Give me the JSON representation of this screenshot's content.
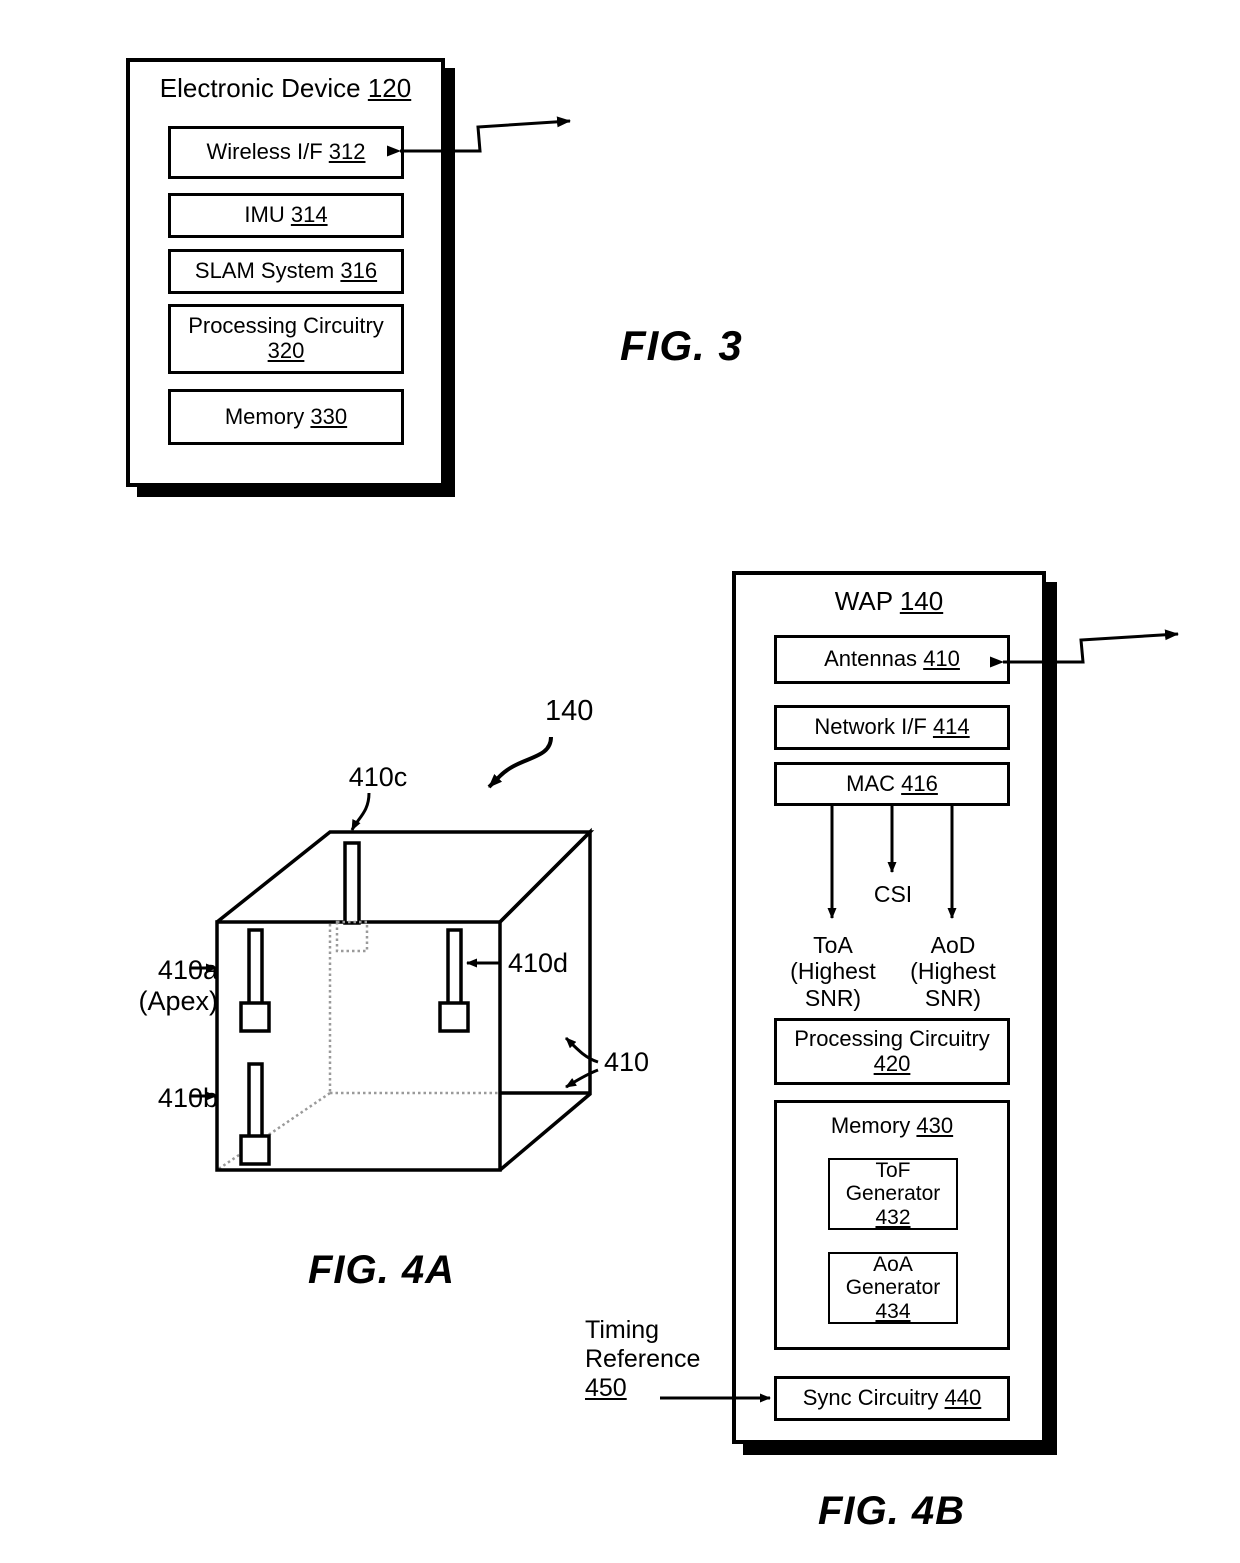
{
  "figure3": {
    "caption": "FIG. 3",
    "title_text": "Electronic Device",
    "title_ref": "120",
    "blocks": [
      {
        "label": "Wireless I/F",
        "ref": "312"
      },
      {
        "label": "IMU",
        "ref": "314"
      },
      {
        "label": "SLAM System",
        "ref": "316"
      },
      {
        "label": "Processing Circuitry",
        "ref": "320"
      },
      {
        "label": "Memory",
        "ref": "330"
      }
    ]
  },
  "figure4a": {
    "caption": "FIG. 4A",
    "device_ref": "140",
    "antenna_group_ref": "410",
    "antennas": [
      {
        "id": "410a",
        "note": "(Apex)"
      },
      {
        "id": "410b",
        "note": ""
      },
      {
        "id": "410c",
        "note": ""
      },
      {
        "id": "410d",
        "note": ""
      }
    ]
  },
  "figure4b": {
    "caption": "FIG. 4B",
    "title_text": "WAP",
    "title_ref": "140",
    "blocks": [
      {
        "label": "Antennas",
        "ref": "410"
      },
      {
        "label": "Network I/F",
        "ref": "414"
      },
      {
        "label": "MAC",
        "ref": "416"
      }
    ],
    "outputs": [
      {
        "label": "ToA",
        "line2": "(Highest",
        "line3": "SNR)"
      },
      {
        "label": "CSI",
        "line2": "",
        "line3": ""
      },
      {
        "label": "AoD",
        "line2": "(Highest",
        "line3": "SNR)"
      }
    ],
    "processing": {
      "label": "Processing Circuitry",
      "ref": "420"
    },
    "memory": {
      "label": "Memory",
      "ref": "430",
      "children": [
        {
          "label": "ToF Generator",
          "ref": "432"
        },
        {
          "label": "AoA Generator",
          "ref": "434"
        }
      ]
    },
    "sync": {
      "label": "Sync Circuitry",
      "ref": "440"
    },
    "timing_reference": {
      "line1": "Timing",
      "line2": "Reference",
      "ref": "450"
    }
  },
  "colors": {
    "ink": "#000000",
    "paper": "#ffffff",
    "hidden_edge": "#8a8a8a"
  }
}
